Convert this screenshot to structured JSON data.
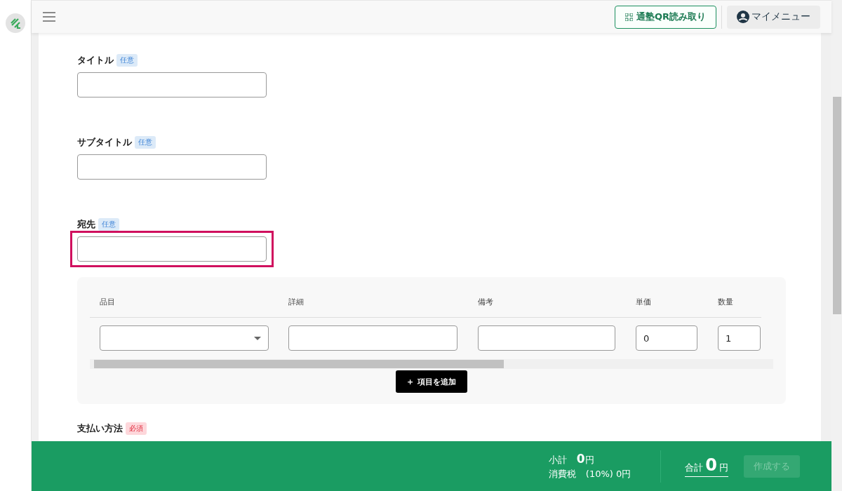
{
  "header": {
    "qr_button": "通塾QR読み取り",
    "my_menu": "マイメニュー"
  },
  "fields": [
    {
      "label": "タイトル",
      "badge": {
        "text": "任意",
        "kind": "optional"
      },
      "highlighted": false
    },
    {
      "label": "サブタイトル",
      "badge": {
        "text": "任意",
        "kind": "optional"
      },
      "highlighted": false
    },
    {
      "label": "宛先",
      "badge": {
        "text": "任意",
        "kind": "optional"
      },
      "highlighted": true
    }
  ],
  "items_table": {
    "columns": [
      "品目",
      "詳細",
      "備考",
      "単価",
      "数量"
    ],
    "row": [
      {
        "kind": "select"
      },
      {
        "kind": "text"
      },
      {
        "kind": "text"
      },
      {
        "kind": "number",
        "value": "0"
      },
      {
        "kind": "number",
        "value": "1"
      }
    ],
    "add_button": {
      "icon": "+",
      "label": "項目を追加"
    }
  },
  "payment": {
    "label": "支払い方法",
    "badge": {
      "text": "必須",
      "kind": "required"
    }
  },
  "footer": {
    "subtotal_label": "小計",
    "subtotal_value": "0",
    "subtotal_unit": "円",
    "tax_label": "消費税",
    "tax_value": "(10%) 0円",
    "total_label": "合計",
    "total_value": "0",
    "total_unit": "円",
    "create_button": {
      "label": "作成する",
      "disabled": true
    }
  }
}
